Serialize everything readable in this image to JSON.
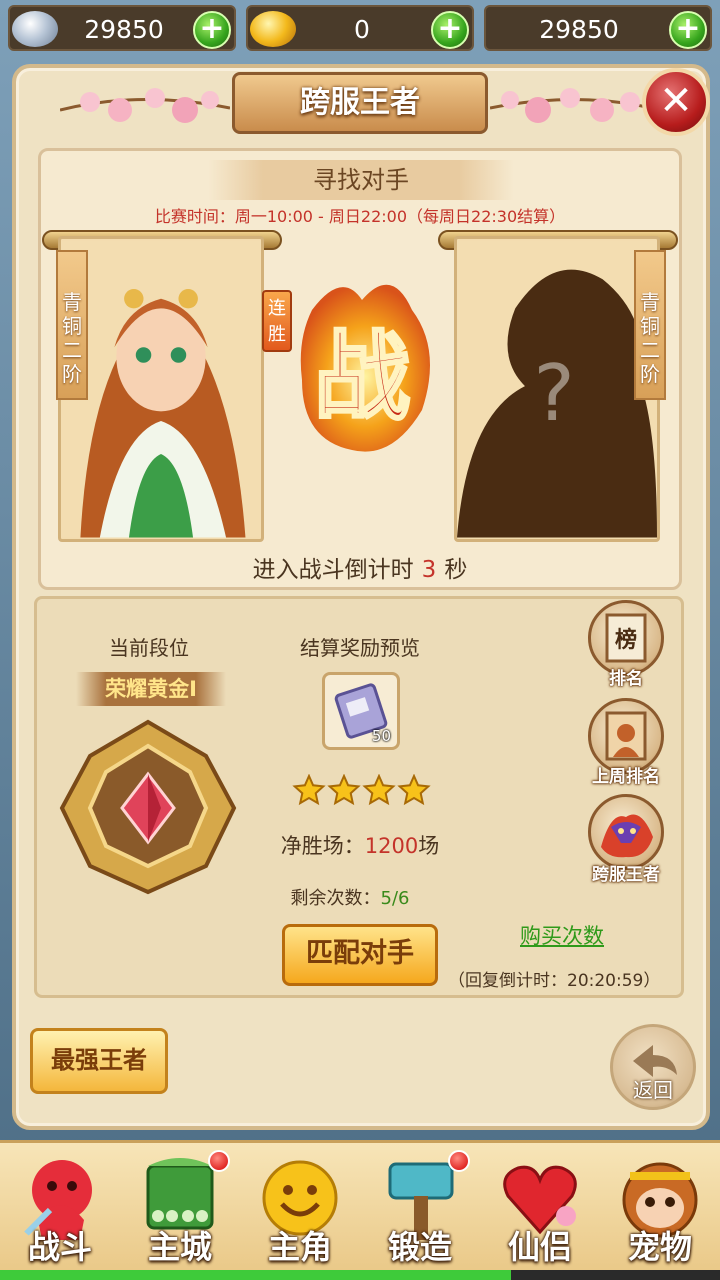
{
  "currency": [
    {
      "icon": "silver-ingot-icon",
      "value": "29850"
    },
    {
      "icon": "gold-ingot-icon",
      "value": "0"
    },
    {
      "icon": "currency-icon",
      "value": "29850"
    }
  ],
  "title": "跨服王者",
  "find_opponent": "寻找对手",
  "match_time": "比赛时间：周一10:00 - 周日22:00（每周日22:30结算）",
  "player": {
    "rank_tag": "青铜二阶",
    "streak": "连胜"
  },
  "opponent": {
    "rank_tag": "青铜二阶"
  },
  "vs_glyph": "战",
  "countdown": {
    "prefix": "进入战斗倒计时",
    "seconds": "3",
    "suffix": "秒"
  },
  "current_rank": {
    "label": "当前段位",
    "name": "荣耀黄金Ⅰ"
  },
  "reward": {
    "label": "结算奖励预览",
    "count": "50",
    "stars": 4
  },
  "net_wins": {
    "label": "净胜场：",
    "value": "1200",
    "unit": "场"
  },
  "remaining": {
    "label": "剩余次数：",
    "value": "5/6"
  },
  "match_button": "匹配对手",
  "buy_button": "购买次数",
  "recover": "（回复倒计时：20:20:59）",
  "side_buttons": [
    {
      "label": "排名",
      "icon": "ranking-scroll-icon",
      "glyph": "榜"
    },
    {
      "label": "上周排名",
      "icon": "last-week-ranking-icon"
    },
    {
      "label": "跨服王者",
      "icon": "cross-server-king-icon"
    }
  ],
  "strongest_button": "最强王者",
  "back_button": "返回",
  "nav": [
    {
      "label": "战斗",
      "icon": "battle-icon",
      "badge": false
    },
    {
      "label": "主城",
      "icon": "main-city-icon",
      "badge": true
    },
    {
      "label": "主角",
      "icon": "hero-icon",
      "badge": false
    },
    {
      "label": "锻造",
      "icon": "forge-hammer-icon",
      "badge": true
    },
    {
      "label": "仙侣",
      "icon": "companion-heart-icon",
      "badge": false
    },
    {
      "label": "宠物",
      "icon": "pet-monkey-icon",
      "badge": false
    }
  ],
  "loading_progress": 0.71,
  "colors": {
    "accent_red": "#c4332a",
    "accent_green": "#3a8a1b",
    "panel_bg": "#efe2c3"
  }
}
